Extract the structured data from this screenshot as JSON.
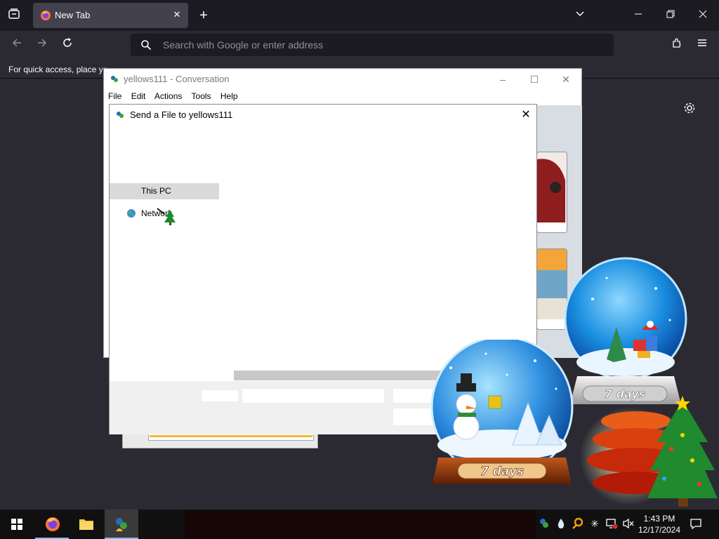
{
  "browser": {
    "tab_title": "New Tab",
    "url_placeholder": "Search with Google or enter address",
    "bookmarks_message": "For quick access, place yo"
  },
  "conversation": {
    "title": "yellows111 - Conversation",
    "menu": [
      "File",
      "Edit",
      "Actions",
      "Tools",
      "Help"
    ]
  },
  "dialog": {
    "title": "Send a File to yellows111",
    "nav": [
      {
        "label": "This PC",
        "selected": true
      },
      {
        "label": "Network",
        "selected": false
      }
    ]
  },
  "gadgets": {
    "globe_large_label": "7 days",
    "globe_small_label": "7 days"
  },
  "taskbar": {
    "time": "1:43 PM",
    "date": "12/17/2024"
  }
}
